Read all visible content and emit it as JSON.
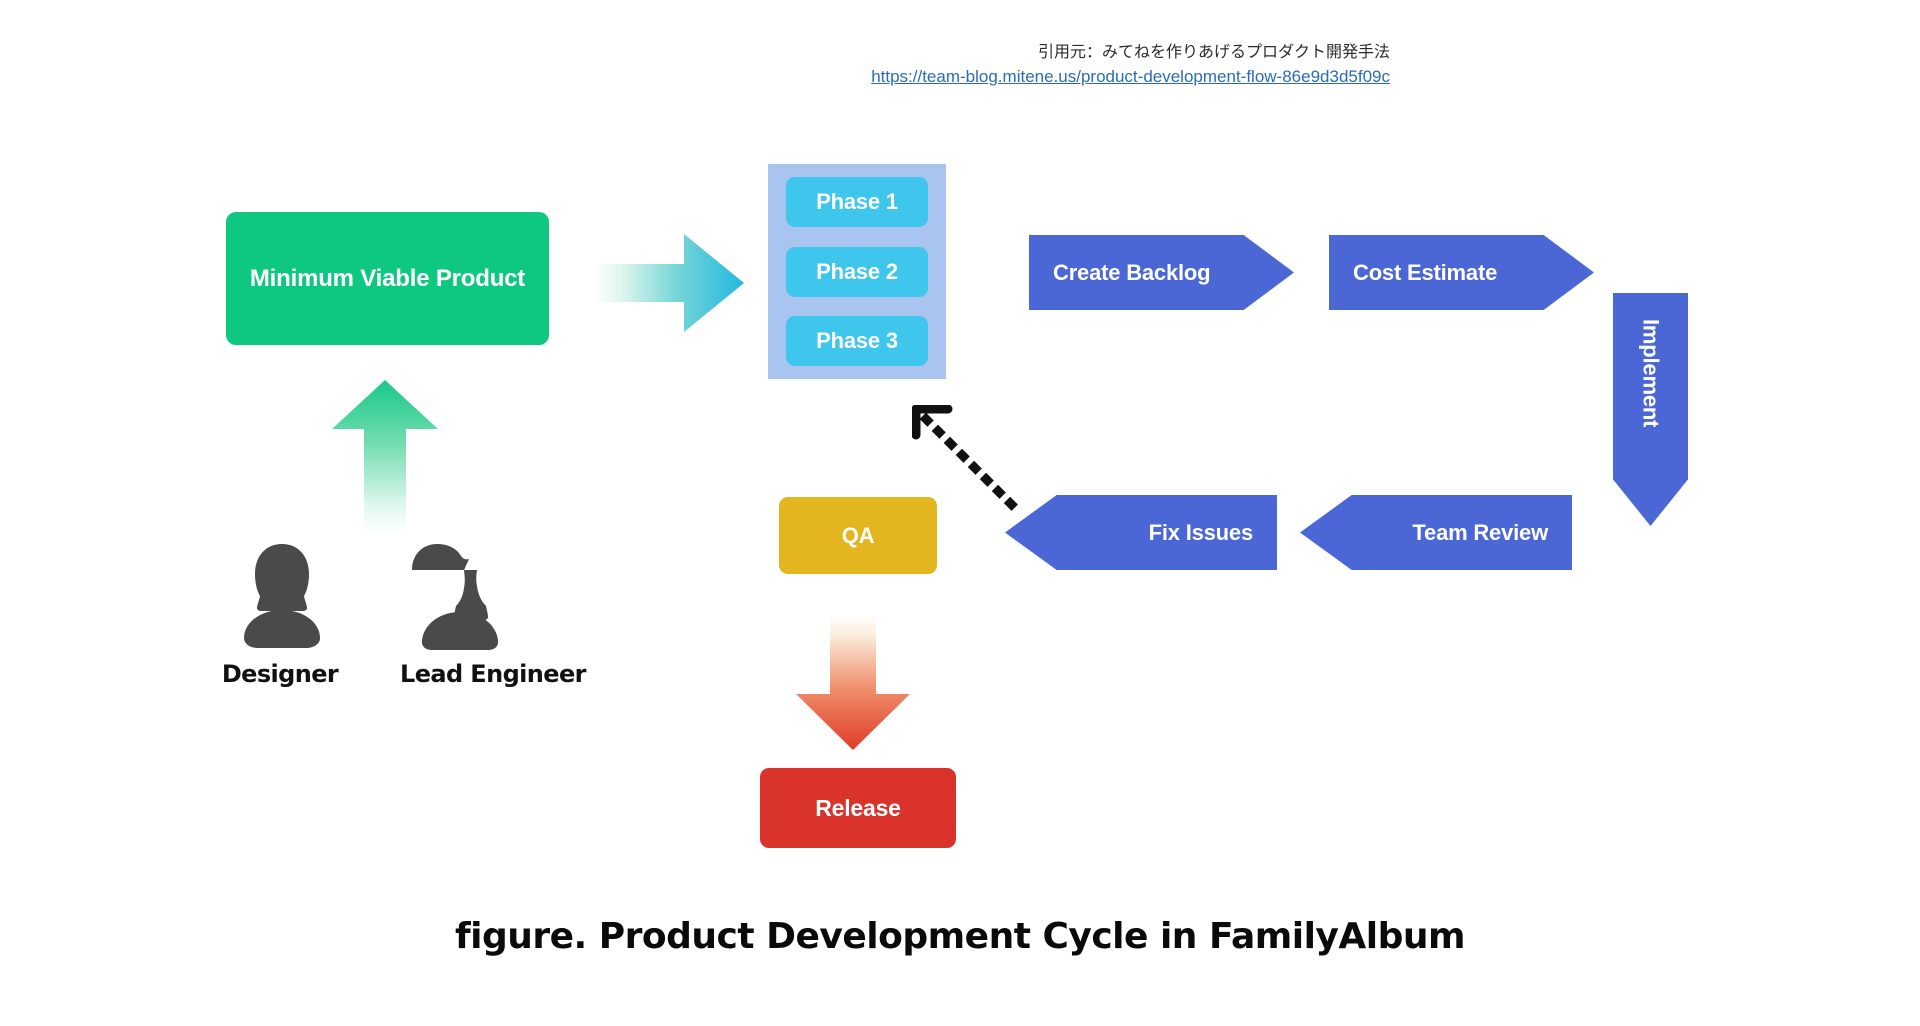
{
  "attribution": {
    "source_label": "引用元：みてねを作りあげるプロダクト開発手法",
    "source_url": "https://team-blog.mitene.us/product-development-flow-86e9d3d5f09c"
  },
  "diagram": {
    "mvp": {
      "label": "Minimum Viable Product",
      "color": "#0ec881"
    },
    "phases": {
      "container_color": "#a9c4ee",
      "pill_color": "#3ec6ec",
      "items": [
        {
          "label": "Phase 1"
        },
        {
          "label": "Phase 2"
        },
        {
          "label": "Phase 3"
        }
      ]
    },
    "flow_steps": [
      {
        "label": "Create Backlog",
        "direction": "right",
        "color": "#4b67d6"
      },
      {
        "label": "Cost Estimate",
        "direction": "right",
        "color": "#4b67d6"
      },
      {
        "label": "Implement",
        "direction": "down",
        "color": "#4b67d6"
      },
      {
        "label": "Team Review",
        "direction": "left",
        "color": "#4b67d6"
      },
      {
        "label": "Fix Issues",
        "direction": "left",
        "color": "#4b67d6"
      }
    ],
    "qa": {
      "label": "QA",
      "color": "#e3b51f"
    },
    "release": {
      "label": "Release",
      "color": "#da332c"
    },
    "people": [
      {
        "label": "Designer",
        "icon": "person-female-icon"
      },
      {
        "label": "Lead Engineer",
        "icon": "person-male-icon"
      }
    ],
    "connectors": {
      "mvp_to_phases": {
        "icon": "arrow-right-gradient-icon",
        "from": "#ffffff",
        "to": "#22b8e0"
      },
      "people_to_mvp": {
        "icon": "arrow-up-gradient-icon",
        "from": "#ffffff",
        "to": "#19c98a"
      },
      "qa_to_release": {
        "icon": "arrow-down-gradient-icon",
        "from": "#ffffff",
        "to": "#df3c28"
      },
      "fix_to_phases": {
        "icon": "dotted-arrow-upleft-icon",
        "color": "#111111"
      }
    }
  },
  "caption": {
    "text": "figure. Product Development Cycle in FamilyAlbum"
  }
}
